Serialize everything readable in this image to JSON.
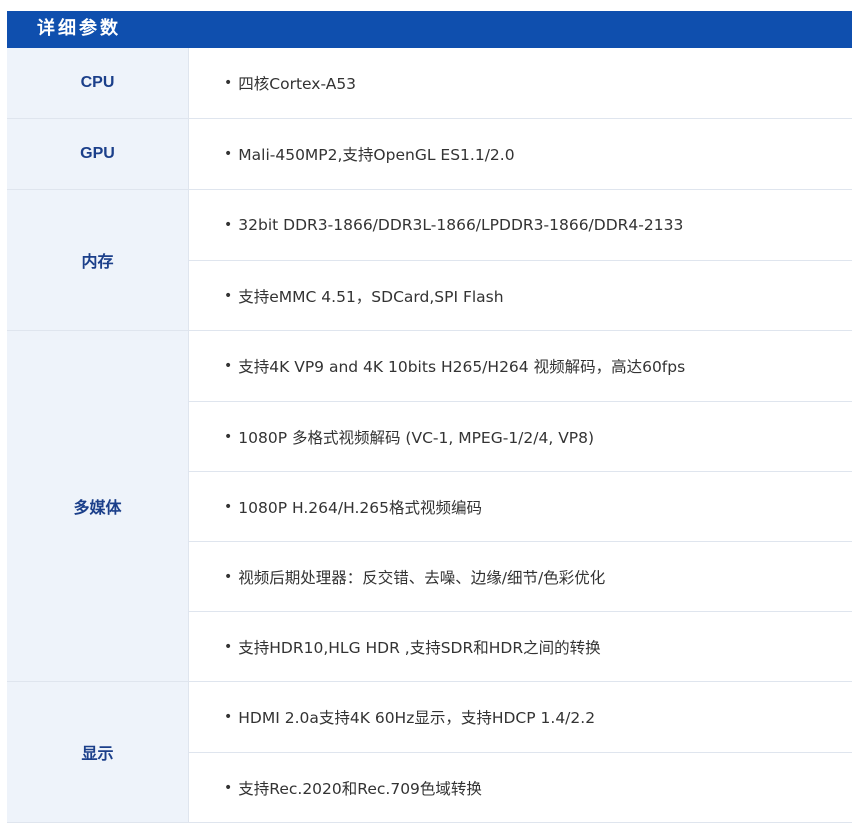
{
  "header": {
    "title": "详细参数"
  },
  "specs": [
    {
      "label": "CPU",
      "values": [
        "四核Cortex-A53"
      ]
    },
    {
      "label": "GPU",
      "values": [
        "Mali-450MP2,支持OpenGL ES1.1/2.0"
      ]
    },
    {
      "label": "内存",
      "values": [
        "32bit DDR3-1866/DDR3L-1866/LPDDR3-1866/DDR4-2133",
        "支持eMMC 4.51，SDCard,SPI Flash"
      ]
    },
    {
      "label": "多媒体",
      "values": [
        "支持4K VP9 and 4K 10bits H265/H264 视频解码，高达60fps",
        "1080P 多格式视频解码 (VC-1, MPEG-1/2/4, VP8)",
        "1080P H.264/H.265格式视频编码",
        "视频后期处理器：反交错、去噪、边缘/细节/色彩优化",
        "支持HDR10,HLG HDR ,支持SDR和HDR之间的转换"
      ]
    },
    {
      "label": "显示",
      "values": [
        "HDMI 2.0a支持4K 60Hz显示，支持HDCP 1.4/2.2",
        "支持Rec.2020和Rec.709色域转换"
      ]
    }
  ],
  "bullet_symbol": "•",
  "colors": {
    "header_bg": "#0f4fae",
    "label_bg": "#eef3fa",
    "label_text": "#1b3f8a",
    "border": "#dfe5ee",
    "value_text": "#333333"
  }
}
